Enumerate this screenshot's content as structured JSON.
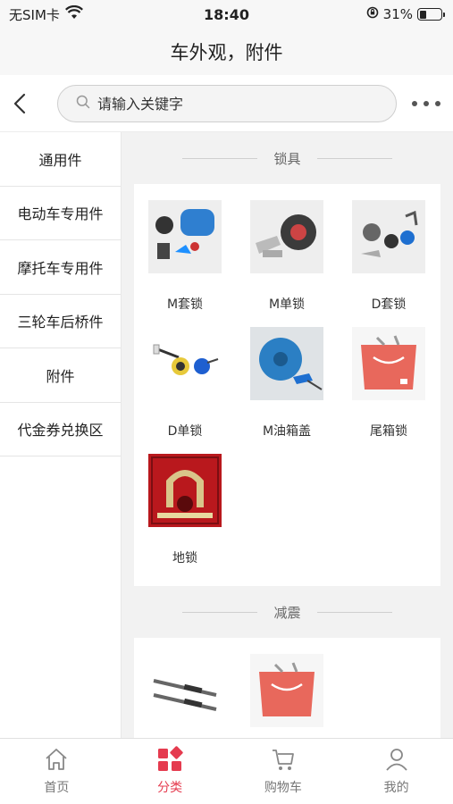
{
  "status": {
    "carrier": "无SIM卡",
    "time": "18:40",
    "battery": "31%",
    "battery_level": 0.31
  },
  "title": "车外观，附件",
  "search": {
    "placeholder": "请输入关键字"
  },
  "sidebar": {
    "items": [
      {
        "label": "通用件"
      },
      {
        "label": "电动车专用件"
      },
      {
        "label": "摩托车专用件"
      },
      {
        "label": "三轮车后桥件"
      },
      {
        "label": "附件"
      },
      {
        "label": "代金券兑换区"
      }
    ]
  },
  "sections": [
    {
      "title": "锁具",
      "products": [
        {
          "name": "M套锁"
        },
        {
          "name": "M单锁"
        },
        {
          "name": "D套锁"
        },
        {
          "name": "D单锁"
        },
        {
          "name": "M油箱盖"
        },
        {
          "name": "尾箱锁"
        },
        {
          "name": "地锁"
        }
      ]
    },
    {
      "title": "减震",
      "products": []
    }
  ],
  "tabbar": {
    "items": [
      {
        "label": "首页"
      },
      {
        "label": "分类"
      },
      {
        "label": "购物车"
      },
      {
        "label": "我的"
      }
    ],
    "active_color": "#e53b4f"
  }
}
